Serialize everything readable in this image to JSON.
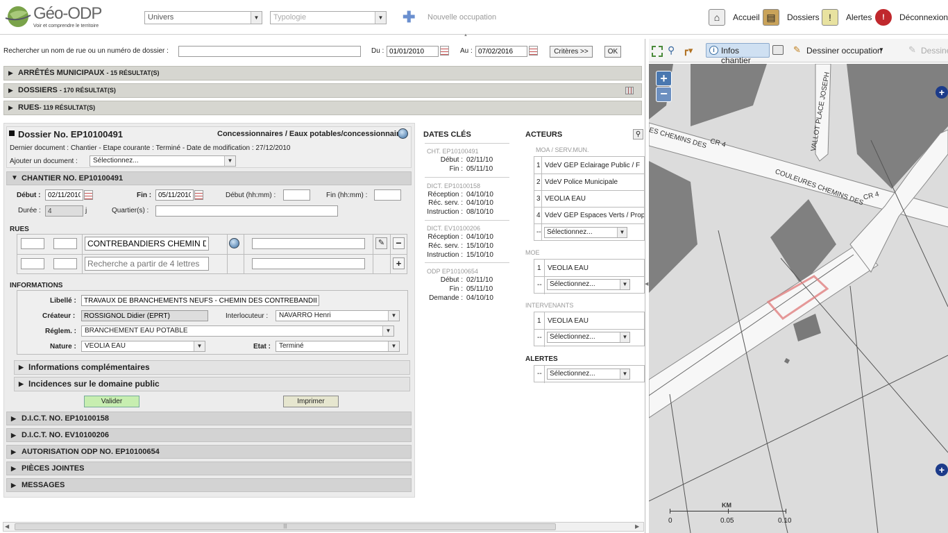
{
  "app": {
    "name": "Géo-ODP",
    "tagline": "Voir et comprendre le territoire"
  },
  "header": {
    "univers_placeholder": "Univers",
    "typologie_placeholder": "Typologie",
    "new_occupation": "Nouvelle occupation",
    "nav": {
      "accueil": "Accueil",
      "dossiers": "Dossiers",
      "alertes": "Alertes",
      "deconnexion": "Déconnexion"
    }
  },
  "search": {
    "label": "Rechercher un nom de rue ou un numéro de dossier :",
    "value": "",
    "du_label": "Du :",
    "du_value": "01/01/2010",
    "au_label": "Au :",
    "au_value": "07/02/2016",
    "criteria_button": "Critères >>",
    "ok_button": "OK"
  },
  "results": [
    {
      "title": "ARRÊTÉS MUNICIPAUX",
      "count": "- 15 RÉSULTAT(S)"
    },
    {
      "title": "DOSSIERS",
      "count": "- 170 RÉSULTAT(S)"
    },
    {
      "title": "RUES",
      "count": "- 119 RÉSULTAT(S)"
    }
  ],
  "dossier": {
    "title": "Dossier No. EP10100491",
    "category": "Concessionnaires / Eaux potables/concessionnaires",
    "last_doc": "Dernier document : Chantier - Etape courante : Terminé - Date de modification : 27/12/2010",
    "add_doc_label": "Ajouter un document :",
    "add_doc_value": "Sélectionnez..."
  },
  "chantier": {
    "title": "CHANTIER NO. EP10100491",
    "debut_label": "Début :",
    "debut_value": "02/11/2010",
    "fin_label": "Fin :",
    "fin_value": "05/11/2010",
    "debut_hm_label": "Début (hh:mm) :",
    "fin_hm_label": "Fin (hh:mm) :",
    "duree_label": "Durée :",
    "duree_value": "4",
    "duree_unit": "j",
    "quartier_label": "Quartier(s) :",
    "rues_title": "RUES",
    "rue1": "CONTREBANDIERS CHEMIN DES",
    "rue_placeholder": "Recherche a partir de 4 lettres",
    "info_title": "INFORMATIONS",
    "libelle_label": "Libellé :",
    "libelle_value": "TRAVAUX DE BRANCHEMENTS NEUFS - CHEMIN DES CONTREBANDIERS",
    "createur_label": "Créateur :",
    "createur_value": "ROSSIGNOL Didier (EPRT)",
    "interlocuteur_label": "Interlocuteur :",
    "interlocuteur_value": "NAVARRO Henri",
    "reglem_label": "Réglem. :",
    "reglem_value": "BRANCHEMENT EAU POTABLE",
    "nature_label": "Nature :",
    "nature_value": "VEOLIA EAU",
    "etat_label": "Etat :",
    "etat_value": "Terminé",
    "info_comp": "Informations complémentaires",
    "incidences": "Incidences sur le domaine public",
    "valider": "Valider",
    "imprimer": "Imprimer"
  },
  "other_sections": [
    "D.I.C.T. NO. EP10100158",
    "D.I.C.T. NO. EV10100206",
    "AUTORISATION ODP NO. EP10100654",
    "PIÈCES JOINTES",
    "MESSAGES"
  ],
  "dates_cles": {
    "title": "DATES CLÉS",
    "groups": [
      {
        "head": "CHT. EP10100491",
        "rows": [
          [
            "Début :",
            "02/11/10"
          ],
          [
            "Fin :",
            "05/11/10"
          ]
        ]
      },
      {
        "head": "DICT. EP10100158",
        "rows": [
          [
            "Réception :",
            "04/10/10"
          ],
          [
            "Réc. serv. :",
            "04/10/10"
          ],
          [
            "Instruction :",
            "08/10/10"
          ]
        ]
      },
      {
        "head": "DICT. EV10100206",
        "rows": [
          [
            "Réception :",
            "04/10/10"
          ],
          [
            "Réc. serv. :",
            "15/10/10"
          ],
          [
            "Instruction :",
            "15/10/10"
          ]
        ]
      },
      {
        "head": "ODP EP10100654",
        "rows": [
          [
            "Début :",
            "02/11/10"
          ],
          [
            "Fin :",
            "05/11/10"
          ],
          [
            "Demande :",
            "04/10/10"
          ]
        ]
      }
    ]
  },
  "acteurs": {
    "title": "ACTEURS",
    "moa_title": "MOA / SERV.MUN.",
    "moa": [
      "VdeV GEP Eclairage Public / F",
      "VdeV Police Municipale",
      "VEOLIA EAU",
      "VdeV GEP Espaces Verts / Prop"
    ],
    "moe_title": "MOE",
    "moe": [
      "VEOLIA EAU"
    ],
    "intervenants_title": "INTERVENANTS",
    "intervenants": [
      "VEOLIA EAU"
    ],
    "alertes_title": "ALERTES",
    "select": "Sélectionnez...",
    "dash": "--"
  },
  "map": {
    "toolbar": {
      "infos": "Infos chantier",
      "dessiner": "Dessiner occupation",
      "dessiner2": "Dessine"
    },
    "labels": {
      "street1": "ES CHEMINS DES",
      "cr4a": "CR 4",
      "vallot": "VALLOT PLACE JOSEPH",
      "street2": "COULEURES CHEMINS DES",
      "cr4b": "CR 4"
    },
    "scale": {
      "unit": "KM",
      "t0": "0",
      "t1": "0.05",
      "t2": "0.10"
    }
  }
}
